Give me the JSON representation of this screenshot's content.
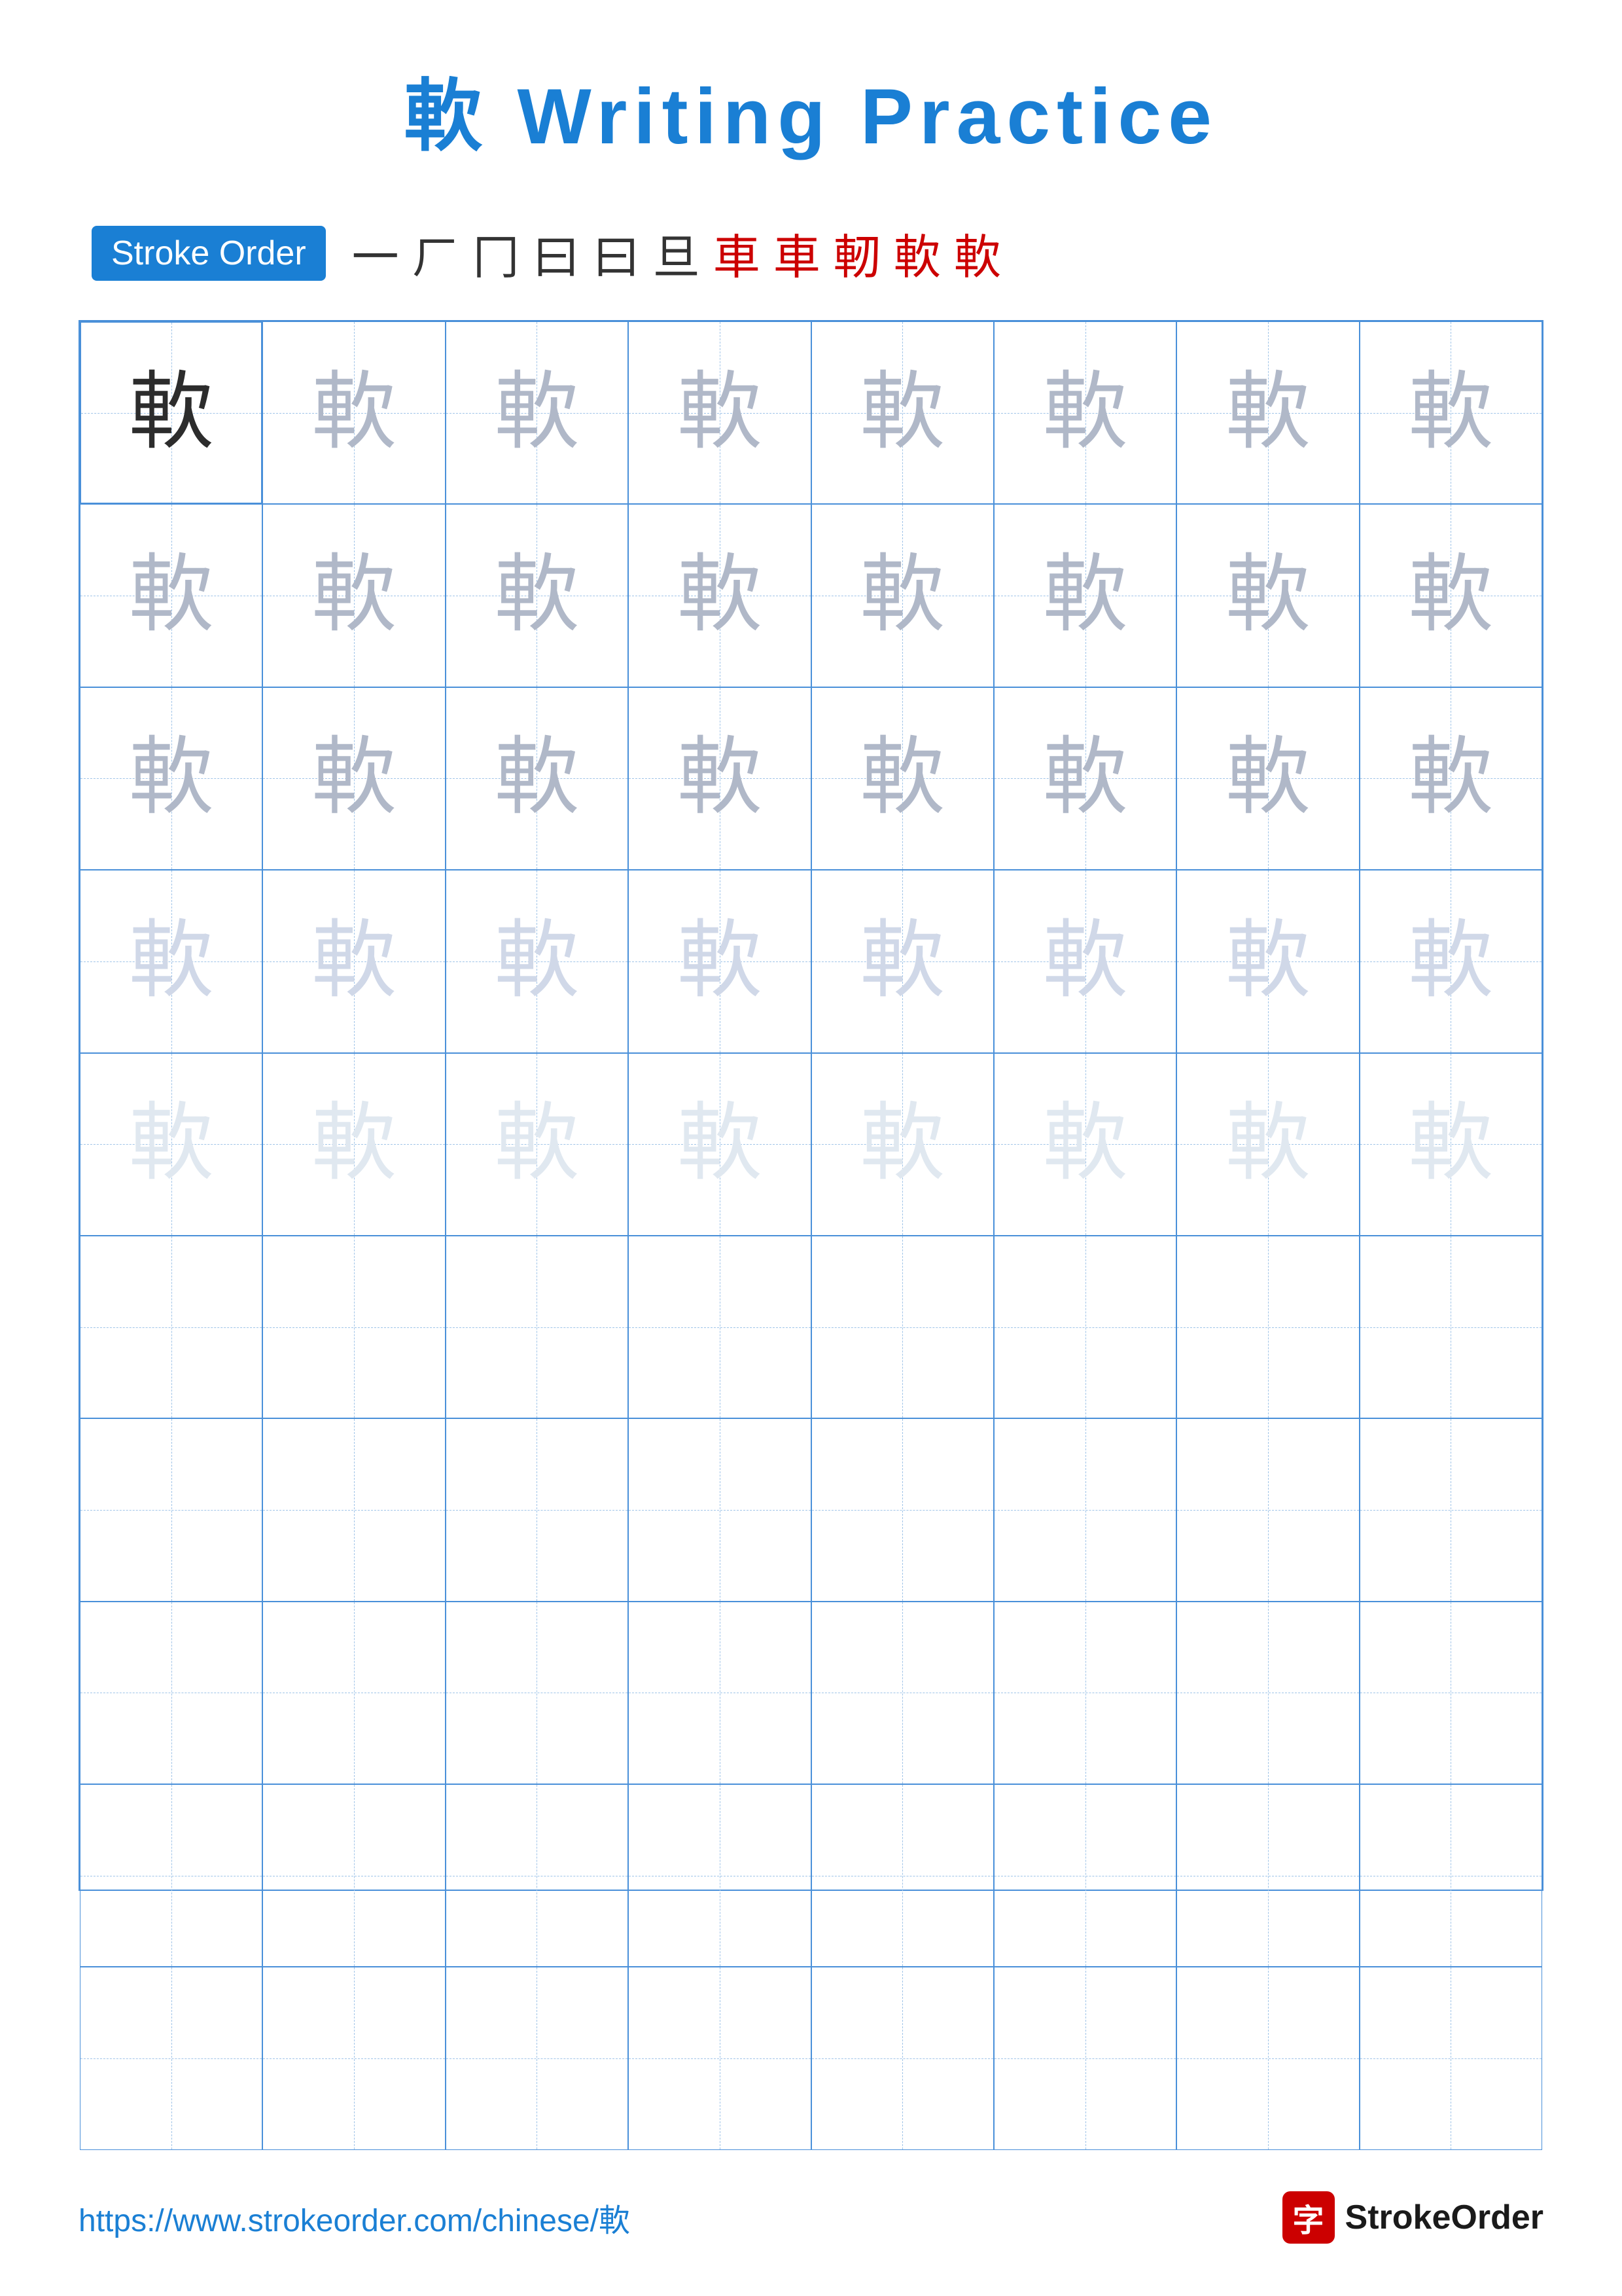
{
  "title": {
    "char": "軟",
    "text": "Writing Practice",
    "full": "軟 Writing Practice"
  },
  "stroke_order": {
    "badge_label": "Stroke Order",
    "strokes": [
      "一",
      "ㄏ",
      "冂",
      "曰",
      "曰",
      "旦",
      "車",
      "車",
      "軔",
      "軟",
      "軟"
    ]
  },
  "grid": {
    "rows": 10,
    "cols": 8,
    "char": "軟",
    "row_styles": [
      "dark",
      "medium",
      "medium",
      "light",
      "very-light",
      "",
      "",
      "",
      "",
      ""
    ]
  },
  "footer": {
    "url": "https://www.strokeorder.com/chinese/軟",
    "logo_text": "StrokeOrder",
    "logo_char": "字"
  },
  "colors": {
    "blue": "#1a7fd4",
    "red": "#cc0000",
    "grid_border": "#4a90d9",
    "grid_dash": "#a0c4e8"
  }
}
